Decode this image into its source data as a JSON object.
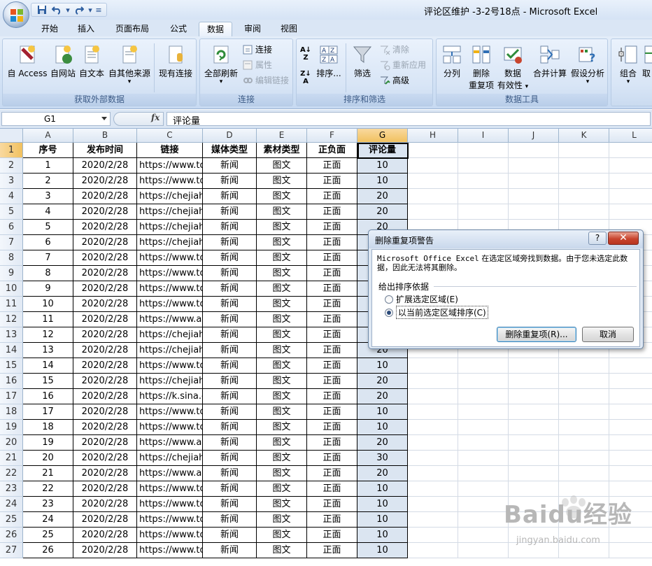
{
  "window": {
    "title": "评论区维护 -3-2号18点 - Microsoft Excel",
    "qat": [
      "save-icon",
      "undo-icon",
      "redo-icon",
      "customize-icon"
    ]
  },
  "tabs": [
    {
      "label": "开始"
    },
    {
      "label": "插入"
    },
    {
      "label": "页面布局"
    },
    {
      "label": "公式"
    },
    {
      "label": "数据",
      "active": true
    },
    {
      "label": "审阅"
    },
    {
      "label": "视图"
    }
  ],
  "ribbon": {
    "external": {
      "label": "获取外部数据",
      "access": "自 Access",
      "web": "自网站",
      "text": "自文本",
      "other": "自其他来源",
      "existing": "现有连接"
    },
    "connections": {
      "label": "连接",
      "refresh_all": "全部刷新",
      "connections": "连接",
      "properties": "属性",
      "edit_links": "编辑链接"
    },
    "sort_filter": {
      "label": "排序和筛选",
      "sort": "排序...",
      "filter": "筛选",
      "clear": "清除",
      "reapply": "重新应用",
      "advanced": "高级"
    },
    "data_tools": {
      "label": "数据工具",
      "text_to_columns": "分列",
      "remove_dup_1": "删除",
      "remove_dup_2": "重复项",
      "validation_1": "数据",
      "validation_2": "有效性",
      "consolidate": "合并计算",
      "whatif": "假设分析"
    },
    "outline": {
      "group": "组合",
      "ungroup": "取"
    }
  },
  "formula_bar": {
    "name_box": "G1",
    "fx": "fx",
    "content": "评论量"
  },
  "sheet": {
    "columns": [
      "A",
      "B",
      "C",
      "D",
      "E",
      "F",
      "G",
      "H",
      "I",
      "J",
      "K",
      "L"
    ],
    "row_numbers": [
      "1",
      "2",
      "3",
      "4",
      "5",
      "6",
      "7",
      "8",
      "9",
      "10",
      "11",
      "12",
      "13",
      "14",
      "15",
      "16",
      "17",
      "18",
      "19",
      "20",
      "21",
      "22",
      "23",
      "24",
      "25",
      "26",
      "27"
    ],
    "headers": [
      "序号",
      "发布时间",
      "链接",
      "媒体类型",
      "素材类型",
      "正负面",
      "评论量"
    ],
    "rows": [
      [
        "1",
        "2020/2/28",
        "https://www.to",
        "新闻",
        "图文",
        "正面",
        "10"
      ],
      [
        "2",
        "2020/2/28",
        "https://www.to",
        "新闻",
        "图文",
        "正面",
        "10"
      ],
      [
        "3",
        "2020/2/28",
        "https://chejiah",
        "新闻",
        "图文",
        "正面",
        "20"
      ],
      [
        "4",
        "2020/2/28",
        "https://chejiah",
        "新闻",
        "图文",
        "正面",
        "20"
      ],
      [
        "5",
        "2020/2/28",
        "https://chejiah",
        "新闻",
        "图文",
        "正面",
        "20"
      ],
      [
        "6",
        "2020/2/28",
        "https://chejiah",
        "新闻",
        "图文",
        "正面",
        ""
      ],
      [
        "7",
        "2020/2/28",
        "https://www.to",
        "新闻",
        "图文",
        "正面",
        ""
      ],
      [
        "8",
        "2020/2/28",
        "https://www.to",
        "新闻",
        "图文",
        "正面",
        ""
      ],
      [
        "9",
        "2020/2/28",
        "https://www.to",
        "新闻",
        "图文",
        "正面",
        ""
      ],
      [
        "10",
        "2020/2/28",
        "https://www.to",
        "新闻",
        "图文",
        "正面",
        ""
      ],
      [
        "11",
        "2020/2/28",
        "https://www.au",
        "新闻",
        "图文",
        "正面",
        ""
      ],
      [
        "12",
        "2020/2/28",
        "https://chejiah",
        "新闻",
        "图文",
        "正面",
        ""
      ],
      [
        "13",
        "2020/2/28",
        "https://chejiah",
        "新闻",
        "图文",
        "正面",
        "20"
      ],
      [
        "14",
        "2020/2/28",
        "https://www.to",
        "新闻",
        "图文",
        "正面",
        "10"
      ],
      [
        "15",
        "2020/2/28",
        "https://chejiah",
        "新闻",
        "图文",
        "正面",
        "20"
      ],
      [
        "16",
        "2020/2/28",
        "https://k.sina.c",
        "新闻",
        "图文",
        "正面",
        "20"
      ],
      [
        "17",
        "2020/2/28",
        "https://www.to",
        "新闻",
        "图文",
        "正面",
        "10"
      ],
      [
        "18",
        "2020/2/28",
        "https://www.to",
        "新闻",
        "图文",
        "正面",
        "10"
      ],
      [
        "19",
        "2020/2/28",
        "https://www.au",
        "新闻",
        "图文",
        "正面",
        "20"
      ],
      [
        "20",
        "2020/2/28",
        "https://chejiah",
        "新闻",
        "图文",
        "正面",
        "30"
      ],
      [
        "21",
        "2020/2/28",
        "https://www.au",
        "新闻",
        "图文",
        "正面",
        "20"
      ],
      [
        "22",
        "2020/2/28",
        "https://www.to",
        "新闻",
        "图文",
        "正面",
        "10"
      ],
      [
        "23",
        "2020/2/28",
        "https://www.to",
        "新闻",
        "图文",
        "正面",
        "10"
      ],
      [
        "24",
        "2020/2/28",
        "https://www.to",
        "新闻",
        "图文",
        "正面",
        "10"
      ],
      [
        "25",
        "2020/2/28",
        "https://www.to",
        "新闻",
        "图文",
        "正面",
        "10"
      ],
      [
        "26",
        "2020/2/28",
        "https://www.to",
        "新闻",
        "图文",
        "正面",
        "10"
      ],
      [
        "27",
        "2020/2/28",
        "https://www.to",
        "新闻",
        "图文",
        "正面",
        "10"
      ]
    ]
  },
  "dialog": {
    "title": "删除重复项警告",
    "help": "?",
    "close": "✕",
    "message_en": "Microsoft Office Excel",
    "message_cn": " 在选定区域旁找到数据。由于您未选定此数据，因此无法将其删除。",
    "group_label": "给出排序依据",
    "option_expand": "扩展选定区域(E)",
    "option_current": "以当前选定区域排序(C)",
    "selected_option": "current",
    "btn_remove": "删除重复项(R)...",
    "btn_cancel": "取消"
  },
  "watermark": {
    "text": "Baidu经验",
    "url": "jingyan.baidu.com"
  }
}
